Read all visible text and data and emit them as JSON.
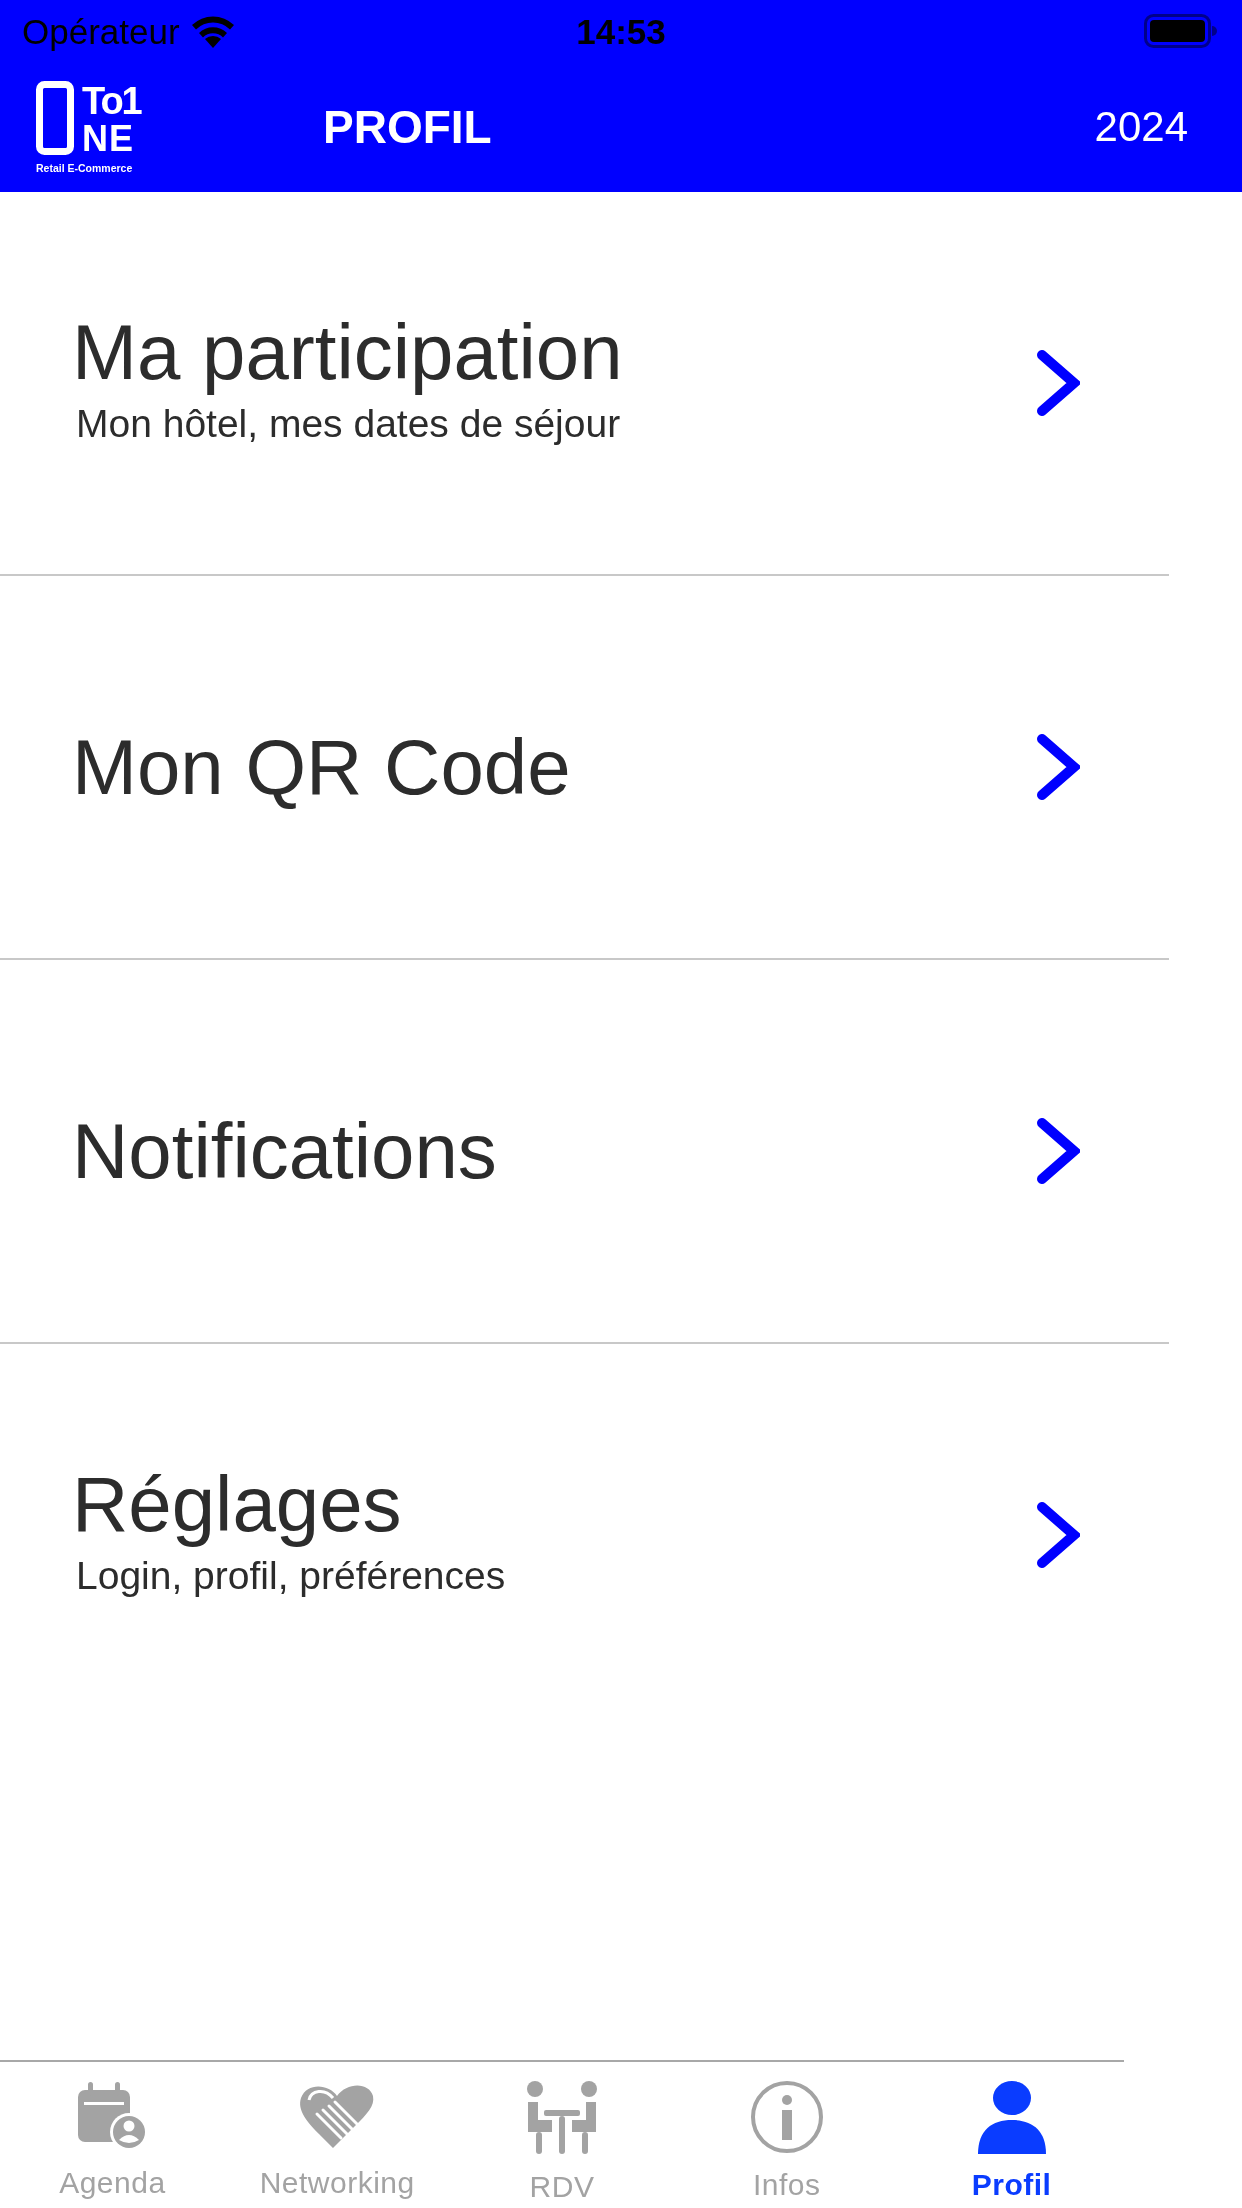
{
  "status_bar": {
    "carrier": "Opérateur",
    "time": "14:53"
  },
  "header": {
    "logo": {
      "line_1": "To1",
      "line_2": "NE",
      "tagline": "Retail E-Commerce"
    },
    "title": "PROFIL",
    "year": "2024"
  },
  "menu": [
    {
      "title": "Ma participation",
      "subtitle": "Mon hôtel, mes dates de séjour"
    },
    {
      "title": "Mon QR Code"
    },
    {
      "title": "Notifications"
    },
    {
      "title": "Réglages",
      "subtitle": "Login, profil, préférences"
    }
  ],
  "tabs": [
    {
      "label": "Agenda",
      "selected": false
    },
    {
      "label": "Networking",
      "selected": false
    },
    {
      "label": "RDV",
      "selected": false
    },
    {
      "label": "Infos",
      "selected": false
    },
    {
      "label": "Profil",
      "selected": true
    }
  ]
}
